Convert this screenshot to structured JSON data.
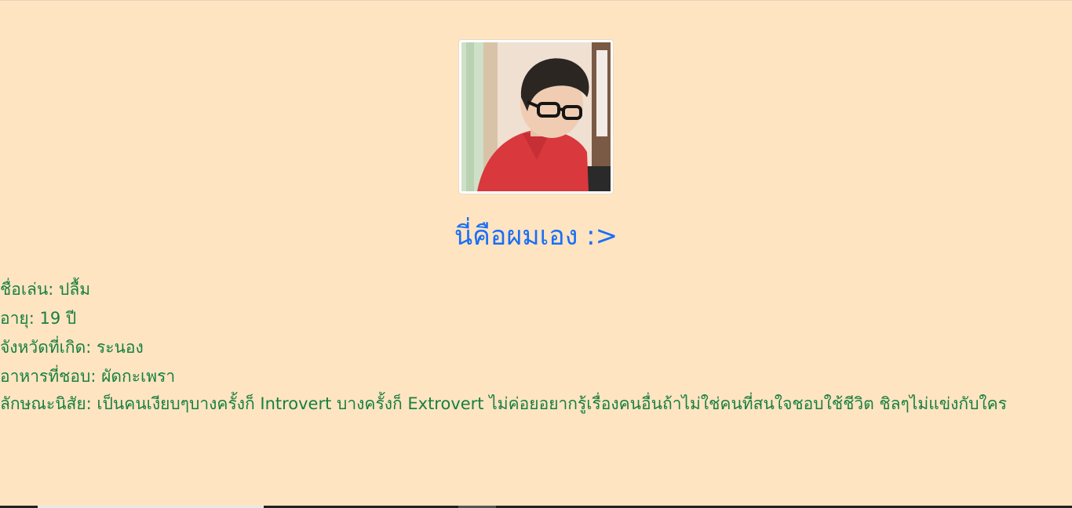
{
  "colors": {
    "background": "#ffe4c2",
    "title": "#1a6ff5",
    "text": "#17803f"
  },
  "profile": {
    "photo_icon": "profile-photo-person-in-red-shirt-with-glasses"
  },
  "title": "นี่คือผมเอง :>",
  "info": {
    "nickname": "ชื่อเล่น: ปลื้ม",
    "age": "อายุ: 19 ปี",
    "birthplace": "จังหวัดที่เกิด: ระนอง",
    "food": "อาหารที่ชอบ: ผัดกะเพรา",
    "personality": "ลักษณะนิสัย: เป็นคนเงียบๆบางครั้งก็ Introvert บางครั้งก็ Extrovert ไม่ค่อยอยากรู้เรื่องคนอื่นถ้าไม่ใช่คนที่สนใจชอบใช้ชีวิต ชิลๆไม่แข่งกับใคร"
  }
}
